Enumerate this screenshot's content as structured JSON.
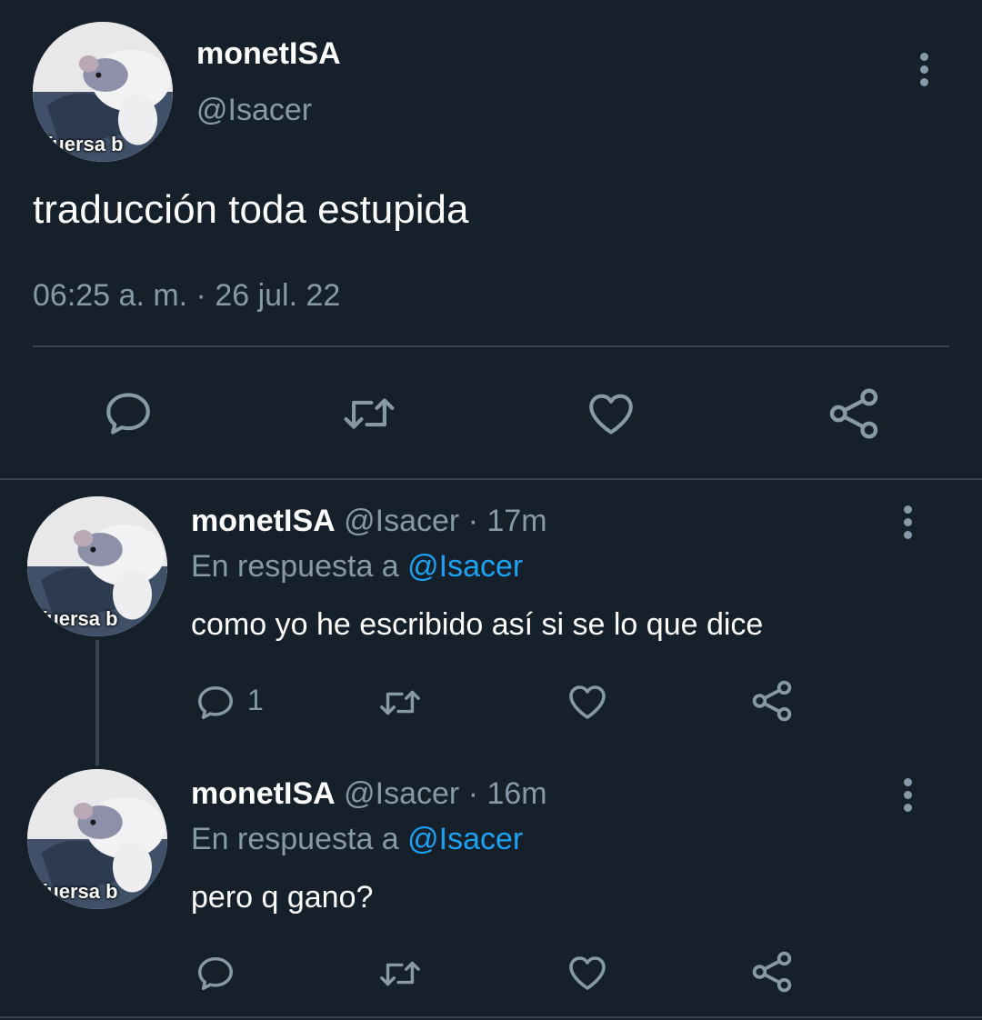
{
  "main_tweet": {
    "display_name": "monetISA",
    "handle": "@Isacer",
    "avatar_caption": "fuersa b",
    "text": "traducción toda estupida",
    "timestamp": "06:25 a. m. · 26 jul. 22"
  },
  "replies": [
    {
      "display_name": "monetISA",
      "handle_time": "@Isacer · 17m",
      "reply_prefix": "En respuesta a",
      "reply_to": "@Isacer",
      "text": "como yo he escribido así si se lo que dice",
      "reply_count": "1",
      "avatar_caption": "fuersa b"
    },
    {
      "display_name": "monetISA",
      "handle_time": "@Isacer · 16m",
      "reply_prefix": "En respuesta a",
      "reply_to": "@Isacer",
      "text": "pero q gano?",
      "reply_count": "",
      "avatar_caption": "fuersa b"
    }
  ],
  "icons": [
    "reply-icon",
    "retweet-icon",
    "like-icon",
    "share-icon",
    "more-options-icon"
  ],
  "colors": {
    "background": "#15202b",
    "primary_text": "#ffffff",
    "secondary_text": "#8899a6",
    "link": "#1da1f2",
    "divider": "#38444d"
  }
}
